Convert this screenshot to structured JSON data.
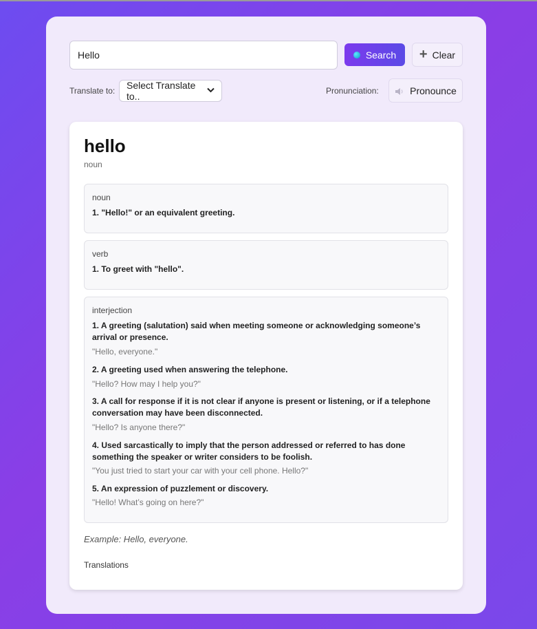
{
  "search": {
    "value": "Hello",
    "button_label": "Search",
    "clear_label": "Clear"
  },
  "options": {
    "translate_label": "Translate to:",
    "translate_selected": "Select Translate to..",
    "pronunciation_label": "Pronunciation:",
    "pronounce_label": "Pronounce"
  },
  "result": {
    "word": "hello",
    "part_of_speech": "noun",
    "meanings": [
      {
        "pos": "noun",
        "definitions": [
          {
            "text": "1. \"Hello!\" or an equivalent greeting.",
            "example": ""
          }
        ]
      },
      {
        "pos": "verb",
        "definitions": [
          {
            "text": "1. To greet with \"hello\".",
            "example": ""
          }
        ]
      },
      {
        "pos": "interjection",
        "definitions": [
          {
            "text": "1. A greeting (salutation) said when meeting someone or acknowledging someone’s arrival or presence.",
            "example": "\"Hello, everyone.\""
          },
          {
            "text": "2. A greeting used when answering the telephone.",
            "example": "\"Hello? How may I help you?\""
          },
          {
            "text": "3. A call for response if it is not clear if anyone is present or listening, or if a telephone conversation may have been disconnected.",
            "example": "\"Hello? Is anyone there?\""
          },
          {
            "text": "4. Used sarcastically to imply that the person addressed or referred to has done something the speaker or writer considers to be foolish.",
            "example": "\"You just tried to start your car with your cell phone. Hello?\""
          },
          {
            "text": "5. An expression of puzzlement or discovery.",
            "example": "\"Hello! What’s going on here?\""
          }
        ]
      }
    ],
    "example": "Example: Hello, everyone.",
    "translations_label": "Translations"
  },
  "colors": {
    "background": "#7a48ea",
    "card": "#f1eafb",
    "accent": "#7c3aed"
  }
}
